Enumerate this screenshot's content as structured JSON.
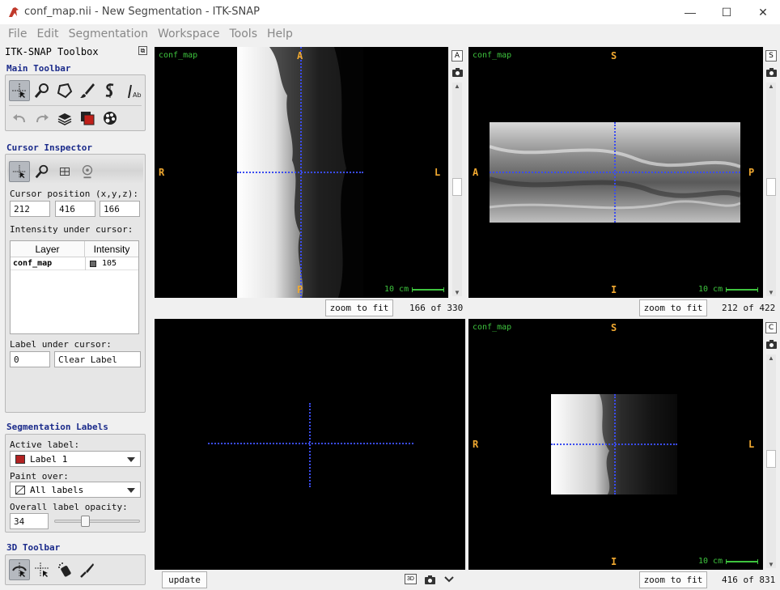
{
  "window": {
    "title": "conf_map.nii - New Segmentation - ITK-SNAP",
    "minimize": "—",
    "maximize": "☐",
    "close": "✕"
  },
  "menu": [
    "File",
    "Edit",
    "Segmentation",
    "Workspace",
    "Tools",
    "Help"
  ],
  "toolbox": {
    "title": "ITK-SNAP Toolbox",
    "main_toolbar_title": "Main Toolbar",
    "cursor_inspector_title": "Cursor Inspector",
    "cursor_position_label": "Cursor position (x,y,z):",
    "cursor_x": "212",
    "cursor_y": "416",
    "cursor_z": "166",
    "intensity_label": "Intensity under cursor:",
    "table_headers": [
      "Layer",
      "Intensity"
    ],
    "table_rows": [
      {
        "layer": "conf_map",
        "intensity": "105",
        "color": "#696969"
      }
    ],
    "label_under_cursor_label": "Label under cursor:",
    "label_id": "0",
    "label_name": "Clear Label",
    "seg_labels_title": "Segmentation Labels",
    "active_label_label": "Active label:",
    "active_label_value": "Label 1",
    "active_label_color": "#b22222",
    "paint_over_label": "Paint over:",
    "paint_over_value": "All labels",
    "opacity_label": "Overall label opacity:",
    "opacity_value": "34",
    "opacity_fraction": 0.34,
    "toolbar3d_title": "3D Toolbar"
  },
  "views": {
    "axial": {
      "layer": "conf_map",
      "orient_top": "A",
      "orient_bottom": "P",
      "orient_left": "R",
      "orient_right": "L",
      "scale": "10 cm",
      "zoom_btn": "zoom to fit",
      "slice": "166 of 330",
      "side_btn": "A"
    },
    "sagittal": {
      "layer": "conf_map",
      "orient_top": "S",
      "orient_bottom": "I",
      "orient_left": "A",
      "orient_right": "P",
      "scale": "10 cm",
      "zoom_btn": "zoom to fit",
      "slice": "212 of 422",
      "side_btn": "S"
    },
    "threed": {
      "update_btn": "update",
      "btn_3d": "3D"
    },
    "coronal": {
      "layer": "conf_map",
      "orient_top": "S",
      "orient_bottom": "I",
      "orient_left": "R",
      "orient_right": "L",
      "scale": "10 cm",
      "zoom_btn": "zoom to fit",
      "slice": "416 of 831",
      "side_btn": "C"
    }
  },
  "colors": {
    "orientation": "#f0a830",
    "overlay_text": "#3ec43e",
    "crosshair": "#3a4cf0",
    "section_title": "#1a2a8a"
  }
}
